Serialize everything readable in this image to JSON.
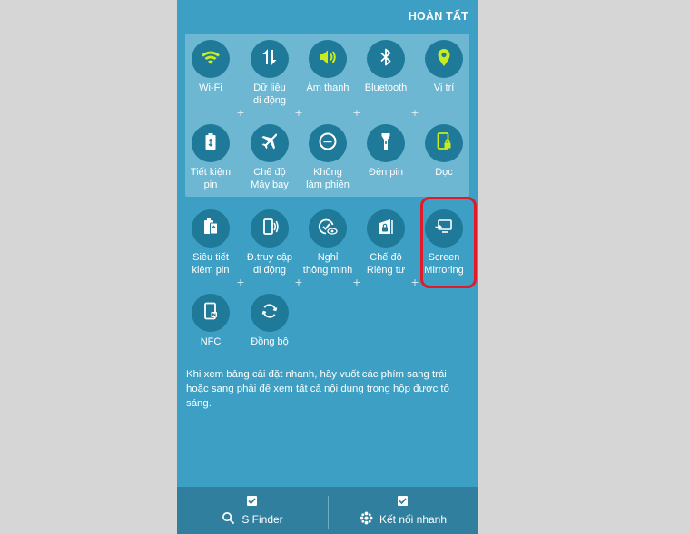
{
  "header": {
    "done_label": "HOÀN TẤT"
  },
  "active_tiles": [
    {
      "label": "Wi-Fi",
      "icon": "wifi-icon",
      "enabled": true
    },
    {
      "label": "Dữ liệu\ndi động",
      "icon": "mobile-data-icon",
      "enabled": false
    },
    {
      "label": "Âm thanh",
      "icon": "sound-icon",
      "enabled": true
    },
    {
      "label": "Bluetooth",
      "icon": "bluetooth-icon",
      "enabled": false
    },
    {
      "label": "Vị trí",
      "icon": "location-icon",
      "enabled": true
    },
    {
      "label": "Tiết kiệm\npin",
      "icon": "power-saving-icon",
      "enabled": false
    },
    {
      "label": "Chế độ\nMáy bay",
      "icon": "airplane-icon",
      "enabled": false
    },
    {
      "label": "Không\nlàm phiền",
      "icon": "do-not-disturb-icon",
      "enabled": false
    },
    {
      "label": "Đèn pin",
      "icon": "flashlight-icon",
      "enabled": false
    },
    {
      "label": "Dọc",
      "icon": "portrait-lock-icon",
      "enabled": true
    }
  ],
  "available_tiles": [
    {
      "label": "Siêu tiết\nkiệm pin",
      "icon": "ultra-power-saving-icon"
    },
    {
      "label": "Đ.truy cập\ndi động",
      "icon": "mobile-hotspot-icon"
    },
    {
      "label": "Nghỉ\nthông minh",
      "icon": "smart-stay-icon"
    },
    {
      "label": "Chế độ\nRiêng tư",
      "icon": "private-mode-icon"
    },
    {
      "label": "Screen\nMirroring",
      "icon": "screen-mirroring-icon"
    },
    {
      "label": "NFC",
      "icon": "nfc-icon"
    },
    {
      "label": "Đồng bộ",
      "icon": "sync-icon"
    }
  ],
  "help_text": "Khi xem bảng cài đặt nhanh, hãy vuốt các phím sang trái hoặc sang phải để xem tất cả nội dung trong hộp được tô sáng.",
  "bottom_bar": {
    "s_finder_label": "S Finder",
    "quick_connect_label": "Kết nối nhanh"
  },
  "colors": {
    "background": "#3d9fc3",
    "panel": "#6db7d3",
    "circle": "#1f7a99",
    "icon_on": "#c8ec1e",
    "icon_off": "#ffffff",
    "highlight": "#e0192b"
  }
}
